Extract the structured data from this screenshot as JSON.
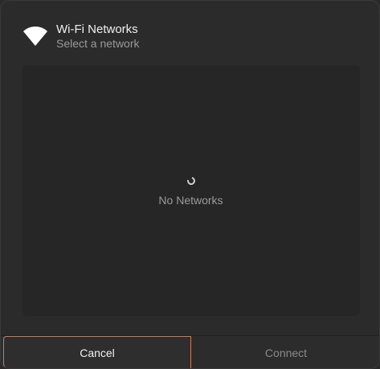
{
  "dialog": {
    "title": "Wi-Fi Networks",
    "subtitle": "Select a network",
    "icon": "wifi-icon"
  },
  "network_list": {
    "empty_text": "No Networks",
    "loading": true,
    "networks": []
  },
  "buttons": {
    "cancel_label": "Cancel",
    "connect_label": "Connect",
    "connect_enabled": false
  },
  "colors": {
    "background": "#2b2b2b",
    "focus_ring": "#d37a52",
    "title_text": "#f0f0f0",
    "muted_text": "#9a9a9a"
  }
}
